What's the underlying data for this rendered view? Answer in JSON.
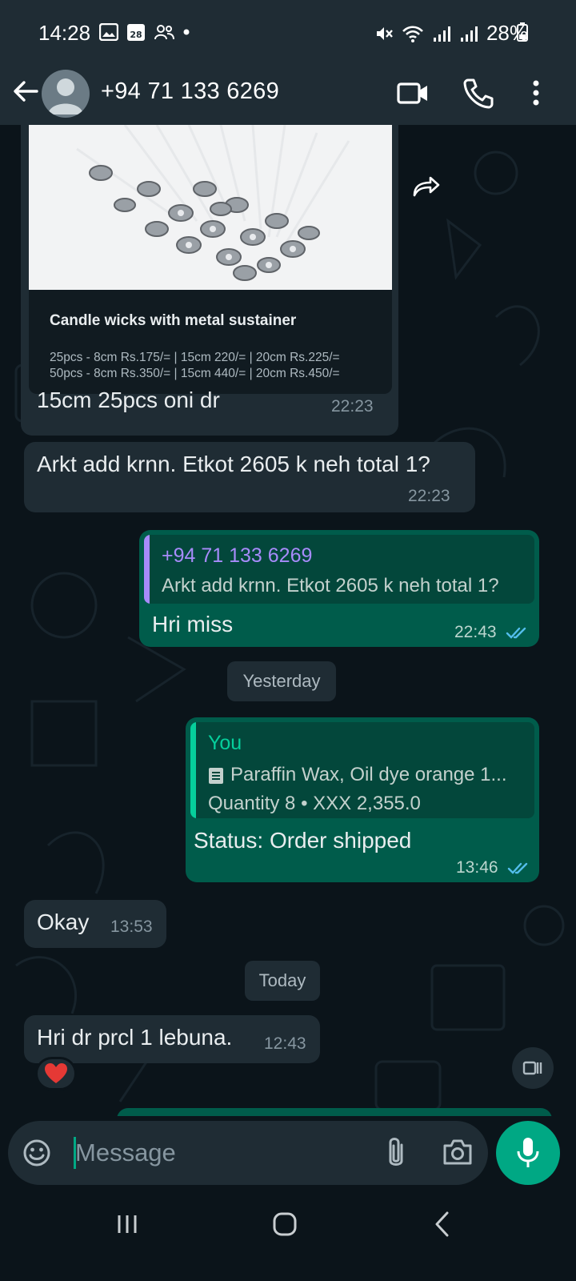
{
  "status_bar": {
    "time": "14:28",
    "calendar_date": "28",
    "battery": "28%"
  },
  "header": {
    "contact": "+94 71 133 6269"
  },
  "messages": {
    "card": {
      "title": "Candle wicks with metal sustainer",
      "line1": "25pcs - 8cm Rs.175/= | 15cm 220/= | 20cm Rs.225/=",
      "line2": "50pcs - 8cm Rs.350/= | 15cm 440/= | 20cm Rs.450/="
    },
    "m1": {
      "text": "15cm 25pcs oni dr",
      "time": "22:23"
    },
    "m2": {
      "text": "Arkt add krnn. Etkot 2605 k neh total 1?",
      "time": "22:23"
    },
    "m3": {
      "quote_name": "+94 71 133 6269",
      "quote_text": "Arkt add krnn. Etkot 2605 k neh total 1?",
      "text": "Hri miss",
      "time": "22:43"
    },
    "date1": "Yesterday",
    "m4": {
      "quote_name": "You",
      "quote_line1": "Paraffin Wax, Oil dye orange 1...",
      "quote_line2": "Quantity 8 • XXX 2,355.0",
      "text": "Status: Order shipped",
      "time": "13:46"
    },
    "m5": {
      "text": "Okay",
      "time": "13:53"
    },
    "date2": "Today",
    "m6": {
      "text": "Hri dr prcl 1 lebuna.",
      "time": "12:43",
      "reaction": "heart"
    }
  },
  "input": {
    "placeholder": "Message"
  },
  "icons": [
    "back-arrow-icon",
    "avatar-icon",
    "video-call-icon",
    "phone-icon",
    "more-vert-icon",
    "forward-icon",
    "read-receipt-icon",
    "catalog-icon",
    "emoji-icon",
    "attach-icon",
    "camera-icon",
    "mic-icon",
    "recent-apps-icon",
    "home-icon",
    "nav-back-icon"
  ],
  "colors": {
    "header_bg": "#1f2c34",
    "chat_bg": "#0b141a",
    "incoming_bubble": "#1f2c34",
    "outgoing_bubble": "#005c4b",
    "accent": "#00a884",
    "tick_blue": "#53bdeb",
    "quote_purple": "#a78bfa",
    "quote_green": "#06cf9c"
  }
}
